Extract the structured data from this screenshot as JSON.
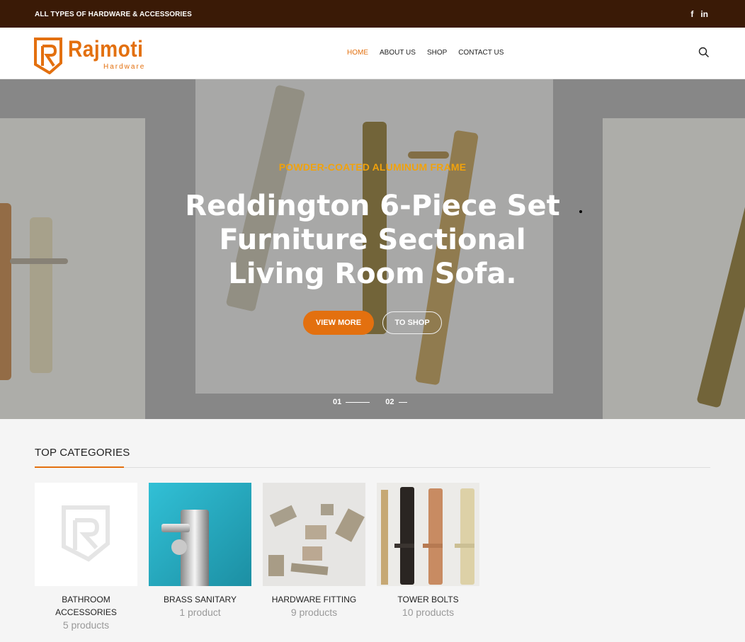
{
  "topbar": {
    "tagline": "ALL TYPES OF HARDWARE & ACCESSORIES",
    "social": {
      "facebook": "f",
      "linkedin": "in"
    }
  },
  "logo": {
    "name": "Rajmoti",
    "sub": "Hardware"
  },
  "nav": {
    "items": [
      {
        "label": "HOME",
        "active": true
      },
      {
        "label": "ABOUT US",
        "active": false
      },
      {
        "label": "SHOP",
        "active": false
      },
      {
        "label": "CONTACT US",
        "active": false
      }
    ]
  },
  "hero": {
    "eyebrow": "POWDER-COATED ALUMINUM FRAME",
    "headline": "Reddington 6-Piece Set Furniture Sectional Living Room Sofa.",
    "primary_button": "VIEW MORE",
    "secondary_button": "TO SHOP",
    "slides": [
      "01",
      "02"
    ]
  },
  "categories": {
    "title": "TOP CATEGORIES",
    "items": [
      {
        "name": "BATHROOM ACCESSORIES",
        "count": "5 products"
      },
      {
        "name": "BRASS SANITARY",
        "count": "1 product"
      },
      {
        "name": "HARDWARE FITTING",
        "count": "9 products"
      },
      {
        "name": "TOWER BOLTS",
        "count": "10 products"
      }
    ]
  },
  "colors": {
    "accent": "#e3700f",
    "topbar": "#3a1a06",
    "eyebrow": "#f1a20b"
  }
}
